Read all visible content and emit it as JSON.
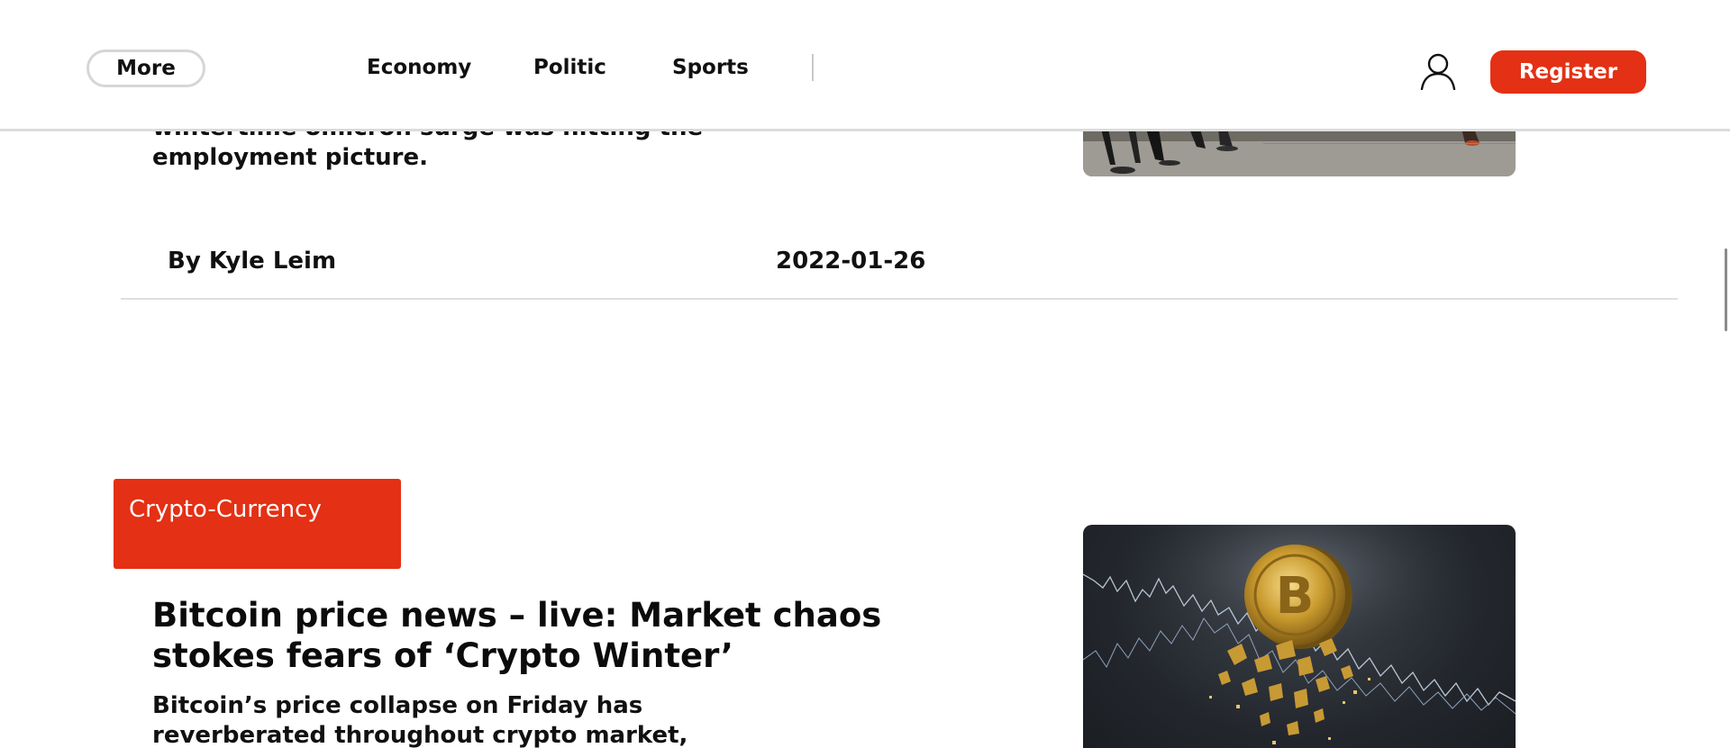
{
  "nav": {
    "more_label": "More",
    "links": [
      "Economy",
      "Politic",
      "Sports"
    ],
    "register_label": "Register",
    "user_icon": "user-icon"
  },
  "previous_article": {
    "summary_partial": "wintertime omicron surge was hitting the employment picture.",
    "author": "By Kyle Leim",
    "date": "2022-01-26"
  },
  "article": {
    "category": "Crypto-Currency",
    "title": "Bitcoin price news – live: Market chaos stokes fears of ‘Crypto Winter’",
    "summary": "Bitcoin’s price collapse on Friday has reverberated throughout crypto market,"
  },
  "colors": {
    "accent": "#e43014",
    "divider": "#dedede",
    "text": "#0b0b0b"
  }
}
